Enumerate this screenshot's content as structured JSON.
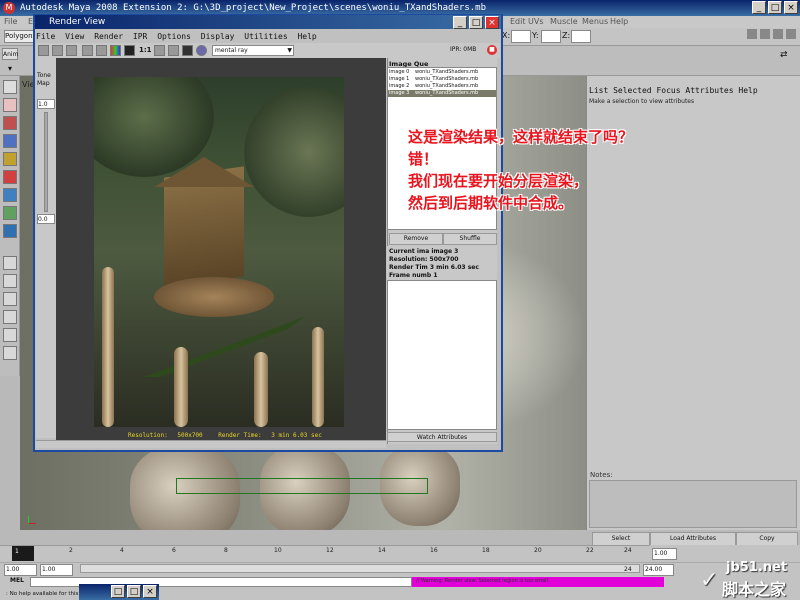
{
  "maya": {
    "title": "Autodesk Maya 2008 Extension 2: G:\\3D_project\\New_Project\\scenes\\woniu_TXandShaders.mb",
    "menus_left": [
      "File",
      "E"
    ],
    "menus_right": [
      "Edit UVs",
      "Muscle",
      "Menus",
      "Help"
    ],
    "shelf_tab": "Polygons",
    "anim_label": "Anim",
    "coord_labels": [
      "X:",
      "Y:",
      "Z:"
    ],
    "viewport_label": "Vie",
    "colors": {
      "title_bar": "#0a246a",
      "cmd_result_bg": "#e100d8",
      "annotation": "#e8141e"
    }
  },
  "render_view": {
    "title": "Render View",
    "menus": [
      "File",
      "View",
      "Render",
      "IPR",
      "Options",
      "Display",
      "Utilities",
      "Help"
    ],
    "ratio_label": "1:1",
    "renderer": "mental ray",
    "ipr_label": "IPR: 0MB",
    "tone_label": "Tone",
    "map_label": "Map",
    "slider_values": [
      "1.0",
      "0.0"
    ],
    "status_resolution_label": "Resolution:",
    "status_resolution": "500x700",
    "status_time_label": "Render Time:",
    "status_time": "3 min 6.03 sec"
  },
  "image_queue": {
    "title": "Image Que",
    "items": [
      {
        "name": "image 0",
        "file": "woniu_TXandShaders.mb"
      },
      {
        "name": "image 1",
        "file": "woniu_TXandShaders.mb"
      },
      {
        "name": "image 2",
        "file": "woniu_TXandShaders.mb"
      },
      {
        "name": "image 3",
        "file": "woniu_TXandShaders.mb"
      }
    ],
    "selected_index": 3,
    "remove_label": "Remove",
    "shuffle_label": "Shuffle",
    "info": {
      "current_label": "Current ima",
      "current_value": "image 3",
      "resolution_label": "Resolution:",
      "resolution_value": "500x700",
      "render_time_label": "Render Tim",
      "render_time_value": "3 min 6.03 sec",
      "frame_label": "Frame numb",
      "frame_value": "1"
    },
    "watch_label": "Watch Attributes"
  },
  "attribute_editor": {
    "menus": [
      "List",
      "Selected",
      "Focus",
      "Attributes",
      "Help"
    ],
    "hint": "Make a selection to view attributes",
    "notes_label": "Notes:",
    "select_label": "Select",
    "load_label": "Load Attributes",
    "copy_label": "Copy"
  },
  "timeline": {
    "ticks": [
      "2",
      "4",
      "6",
      "8",
      "10",
      "12",
      "14",
      "16",
      "18",
      "20",
      "22",
      "24"
    ],
    "current_frame": "1",
    "end_frame": "24",
    "range_start": "1.00",
    "range_field": "1.00",
    "anim_end": "24.00",
    "playback_start": "1.00"
  },
  "command_line": {
    "mel_label": "MEL",
    "result": "// Warning: Render view: Selected region is too small",
    "help": ": No help available for this to"
  },
  "annotation": {
    "lines": [
      "这是渲染结果，这样就结束了吗？",
      "错！",
      "我们现在要开始分层渲染，",
      "然后到后期软件中合成。"
    ]
  },
  "watermark": {
    "url": "jb51.net",
    "name": "脚本之家"
  }
}
